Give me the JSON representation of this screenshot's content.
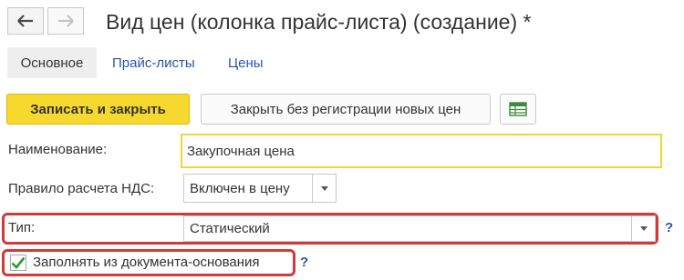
{
  "header": {
    "title": "Вид цен (колонка прайс-листа) (создание) *",
    "back_icon": "arrow-left-icon",
    "forward_icon": "arrow-right-icon"
  },
  "tabs": [
    {
      "label": "Основное",
      "active": true
    },
    {
      "label": "Прайс-листы",
      "active": false
    },
    {
      "label": "Цены",
      "active": false
    }
  ],
  "toolbar": {
    "save_close_label": "Записать и закрыть",
    "close_no_register_label": "Закрыть без регистрации новых цен",
    "table_icon": "table-icon"
  },
  "form": {
    "name": {
      "label": "Наименование:",
      "value": "Закупочная цена"
    },
    "vat_rule": {
      "label": "Правило расчета НДС:",
      "value": "Включен в цену"
    },
    "type": {
      "label": "Тип:",
      "value": "Статический",
      "help": "?"
    },
    "fill_from_base": {
      "label": "Заполнять из документа-основания",
      "checked": true,
      "help": "?"
    }
  },
  "colors": {
    "accent_yellow": "#f7d82e",
    "link_blue": "#2a55a5",
    "highlight_red": "#d03a3a",
    "check_green": "#2e9b3a"
  }
}
